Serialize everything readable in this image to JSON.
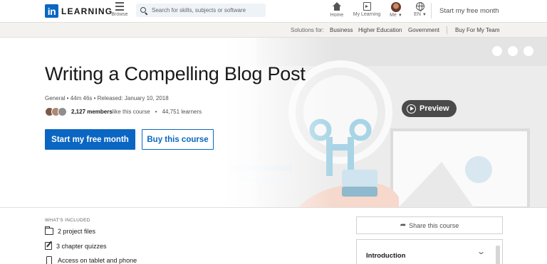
{
  "nav": {
    "logo_text": "LEARNING",
    "logo_badge": "in",
    "browse_label": "Browse",
    "search_placeholder": "Search for skills, subjects or software",
    "home_label": "Home",
    "my_learning_label": "My Learning",
    "me_label": "Me",
    "language_label": "EN",
    "free_month_label": "Start my free month"
  },
  "solutions": {
    "label": "Solutions for:",
    "links": [
      "Business",
      "Higher Education",
      "Government"
    ],
    "team_label": "Buy For My Team"
  },
  "course": {
    "title": "Writing a Compelling Blog Post",
    "meta": "General  •  44m 46s  •  Released: January 10, 2018",
    "members_count": "2,127 members",
    "members_suffix": " like this course",
    "learners": "44,751 learners",
    "primary_cta": "Start my free month",
    "secondary_cta": "Buy this course",
    "preview_label": "Preview"
  },
  "included": {
    "heading": "WHAT'S INCLUDED",
    "items": [
      "2 project files",
      "3 chapter quizzes",
      "Access on tablet and phone"
    ]
  },
  "sidebar": {
    "share_label": "Share this course",
    "toc_first_chapter": "Introduction"
  },
  "colors": {
    "brand": "#0a66c2",
    "art_blue": "#a8d4e6",
    "art_grey": "#e6e6e6"
  },
  "icons": [
    "browse-grid-icon",
    "search-icon",
    "home-icon",
    "my-learning-icon",
    "globe-icon",
    "play-icon",
    "share-icon",
    "folder-icon",
    "quiz-icon",
    "phone-icon",
    "chevron-down-icon"
  ]
}
